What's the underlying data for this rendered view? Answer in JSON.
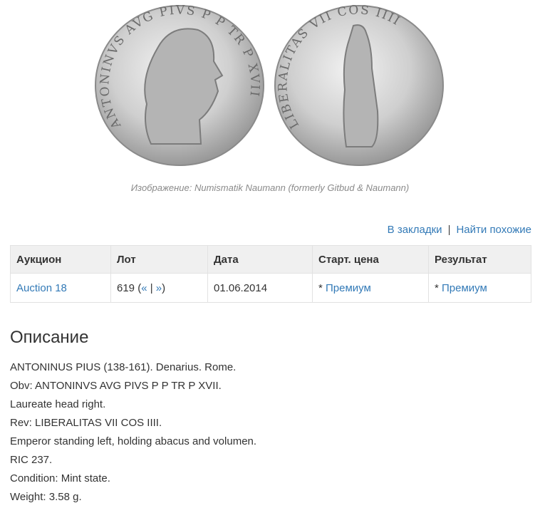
{
  "image": {
    "caption": "Изображение: Numismatik Naumann (formerly Gitbud & Naumann)",
    "obverse_legend": "ANTONINVS AVG PIVS P P TR P XVII",
    "reverse_legend": "LIBERALITAS VII COS IIII"
  },
  "actions": {
    "bookmark": "В закладки",
    "separator": "|",
    "find_similar": "Найти похожие"
  },
  "table": {
    "headers": [
      "Аукцион",
      "Лот",
      "Дата",
      "Старт. цена",
      "Результат"
    ],
    "row": {
      "auction": "Auction 18",
      "lot_number": "619",
      "lot_open": "(",
      "prev": "«",
      "lot_sep": "|",
      "next": "»",
      "lot_close": ")",
      "date": "01.06.2014",
      "start_price_prefix": "*",
      "start_price_link": "Премиум",
      "result_prefix": "*",
      "result_link": "Премиум"
    }
  },
  "description": {
    "title": "Описание",
    "lines": [
      "ANTONINUS PIUS (138-161). Denarius. Rome.",
      "Obv: ANTONINVS AVG PIVS P P TR P XVII.",
      "Laureate head right.",
      "Rev: LIBERALITAS VII COS IIII.",
      "Emperor standing left, holding abacus and volumen.",
      "RIC 237.",
      "Condition: Mint state.",
      "Weight: 3.58 g."
    ]
  },
  "colors": {
    "link": "#337ab7",
    "header_bg": "#f0f0f0",
    "coin_silver": "#c9c9c9"
  }
}
